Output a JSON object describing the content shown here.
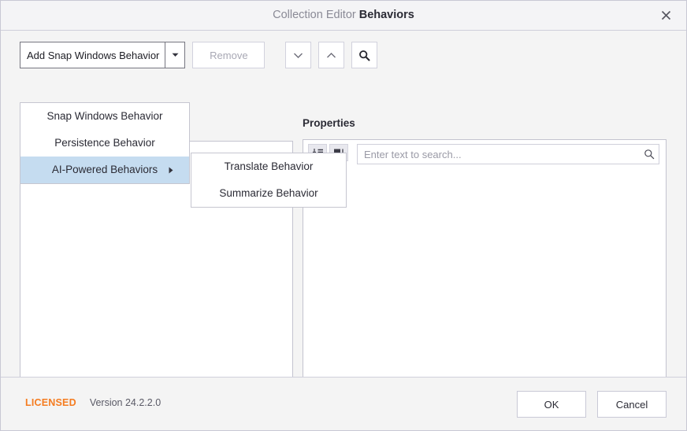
{
  "window": {
    "title_prefix": "Collection Editor",
    "title_main": "Behaviors",
    "close_icon": "close-icon"
  },
  "toolbar": {
    "add_label": "Add Snap Windows Behavior",
    "dropdown_icon": "chevron-down-icon",
    "remove_label": "Remove",
    "move_down_icon": "chevron-down-icon",
    "move_up_icon": "chevron-up-icon",
    "search_icon": "search-icon"
  },
  "menu": {
    "items": [
      {
        "label": "Snap Windows Behavior",
        "selected": false,
        "has_submenu": false
      },
      {
        "label": "Persistence Behavior",
        "selected": false,
        "has_submenu": false
      },
      {
        "label": "AI-Powered Behaviors",
        "selected": true,
        "has_submenu": true
      }
    ],
    "submenu": {
      "items": [
        {
          "label": "Translate Behavior"
        },
        {
          "label": "Summarize Behavior"
        }
      ]
    },
    "submenu_arrow_icon": "caret-right-icon",
    "highlight_color": "#c5dcf0"
  },
  "properties": {
    "header": "Properties",
    "categorized_icon": "sort-categorized-icon",
    "alphabetical_icon": "sort-alphabetical-icon",
    "search": {
      "value": "",
      "placeholder": "Enter text to search...",
      "icon": "search-icon"
    }
  },
  "footer": {
    "license_tag": "LICENSED",
    "license_color": "#f57c20",
    "version": "Version 24.2.2.0",
    "ok_label": "OK",
    "cancel_label": "Cancel"
  }
}
